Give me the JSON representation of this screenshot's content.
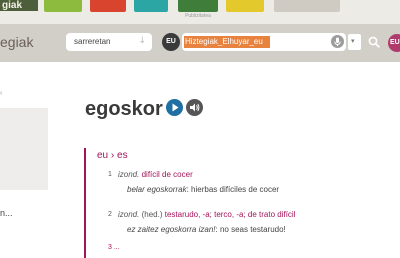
{
  "top_strip": {
    "logo_text": "giak",
    "sponsor_caption": "Publizitatea"
  },
  "header": {
    "site_name": "egiak",
    "direction": {
      "label": "sarreretan",
      "arrow": "↓"
    },
    "lang_badge": "EU",
    "search": {
      "value": "Hiztegiak_Elhuyar_eu",
      "placeholder": ""
    },
    "dropdown_arrow": "▾",
    "user_badge": "EU"
  },
  "sidebar": {
    "top_mark": "‹",
    "ellipsis_text": "n..."
  },
  "entry": {
    "headword": "egoskor",
    "lang_pair": "eu › es",
    "senses": [
      {
        "num": "1",
        "gram": "izond.",
        "translation": "difícil de cocer",
        "example_src": "belar egoskorrak",
        "example_tgt": "hierbas difíciles de cocer"
      },
      {
        "num": "2",
        "gram": "izond.",
        "usage": "(hed.)",
        "translation": "testarudo, -a; terco, -a;",
        "note": "de trato difícil",
        "example_src": "ez zaitez egoskorra izan!",
        "example_tgt": "no seas testarudo!"
      }
    ],
    "cut_text": "3 ..."
  },
  "colors": {
    "accent": "#a3135a",
    "search_highlight": "#e8823f",
    "header_bg": "#d2cec8",
    "play": "#1f6fa3"
  },
  "icons": {
    "play": "play-icon",
    "audio": "speaker-icon",
    "mic": "microphone-icon",
    "search": "search-icon"
  }
}
